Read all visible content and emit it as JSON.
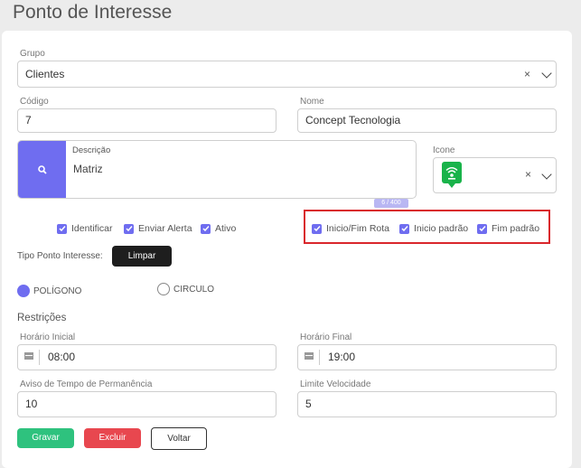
{
  "page_title": "Ponto de Interesse",
  "grupo": {
    "label": "Grupo",
    "value": "Clientes",
    "clear": "×"
  },
  "codigo": {
    "label": "Código",
    "value": "7"
  },
  "nome": {
    "label": "Nome",
    "value": "Concept Tecnologia"
  },
  "descricao": {
    "label": "Descrição",
    "value": "Matriz",
    "counter": "6 / 400"
  },
  "icone": {
    "label": "Icone",
    "clear": "×",
    "icon": "green-map-pin-signal-icon"
  },
  "checkboxes_left": [
    {
      "label": "Identificar",
      "checked": true
    },
    {
      "label": "Enviar Alerta",
      "checked": true
    },
    {
      "label": "Ativo",
      "checked": true
    }
  ],
  "checkboxes_right": [
    {
      "label": "Inicio/Fim Rota",
      "checked": true
    },
    {
      "label": "Inicio padrão",
      "checked": true
    },
    {
      "label": "Fim padrão",
      "checked": true
    }
  ],
  "tipo": {
    "label": "Tipo Ponto Interesse:",
    "limpar": "Limpar"
  },
  "shape_options": [
    {
      "label": "POLÍGONO",
      "selected": true
    },
    {
      "label": "CIRCULO",
      "selected": false
    }
  ],
  "restricoes": {
    "title": "Restrições",
    "horario_inicial": {
      "label": "Horário Inicial",
      "value": "08:00"
    },
    "horario_final": {
      "label": "Horário Final",
      "value": "19:00"
    },
    "aviso": {
      "label": "Aviso de Tempo de Permanência",
      "value": "10"
    },
    "limite": {
      "label": "Limite Velocidade",
      "value": "5"
    }
  },
  "actions": {
    "gravar": "Gravar",
    "excluir": "Excluir",
    "voltar": "Voltar"
  },
  "colors": {
    "accent": "#6f6df0",
    "save": "#2ec27e",
    "delete": "#e8474f",
    "highlight": "#d9262c"
  }
}
